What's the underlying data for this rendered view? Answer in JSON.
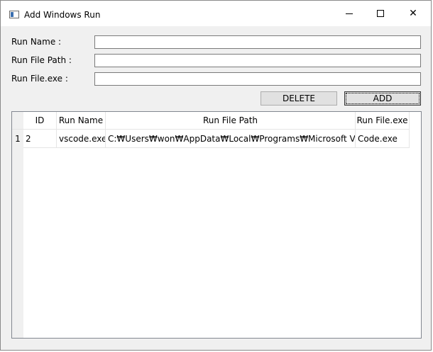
{
  "window": {
    "title": "Add Windows Run",
    "icon": "app-window-icon",
    "controls": {
      "minimize": "minimize-icon",
      "maximize": "maximize-icon",
      "close": "✕"
    }
  },
  "form": {
    "run_name_label": "Run Name :",
    "run_name_value": "",
    "run_path_label": "Run File Path :",
    "run_path_value": "",
    "run_exe_label": "Run File.exe :",
    "run_exe_value": ""
  },
  "buttons": {
    "delete": "DELETE",
    "add": "ADD"
  },
  "table": {
    "columns": [
      "ID",
      "Run Name",
      "Run File Path",
      "Run File.exe"
    ],
    "rows": [
      {
        "row_number": "1",
        "id": "2",
        "run_name": "vscode.exe",
        "run_path": "C:₩Users₩won₩AppData₩Local₩Programs₩Microsoft VS Code",
        "run_exe": "Code.exe"
      }
    ]
  }
}
